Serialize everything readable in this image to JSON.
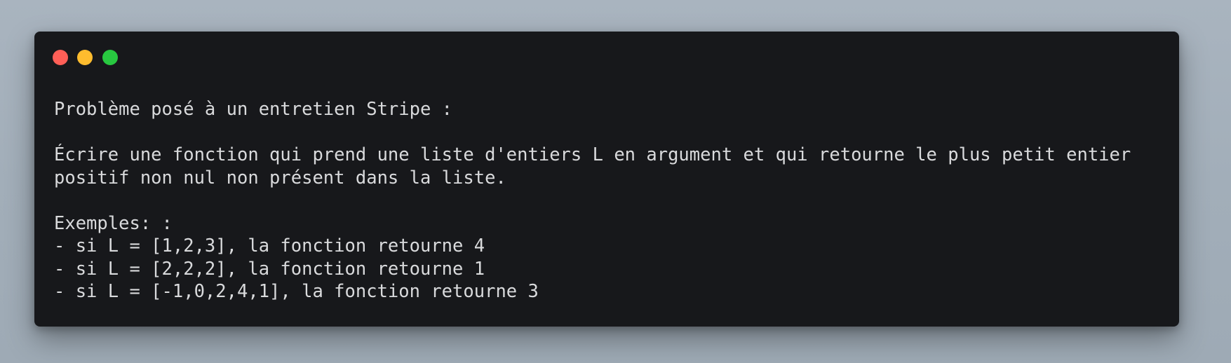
{
  "window": {
    "controls": {
      "close_color": "#ff5f57",
      "minimize_color": "#febc2e",
      "zoom_color": "#28c840"
    }
  },
  "content": {
    "lines": [
      "Problème posé à un entretien Stripe :",
      "",
      "Écrire une fonction qui prend une liste d'entiers L en argument et qui retourne le plus petit entier",
      "positif non nul non présent dans la liste.",
      "",
      "Exemples: :",
      "- si L = [1,2,3], la fonction retourne 4",
      "- si L = [2,2,2], la fonction retourne 1",
      "- si L = [-1,0,2,4,1], la fonction retourne 3"
    ]
  }
}
